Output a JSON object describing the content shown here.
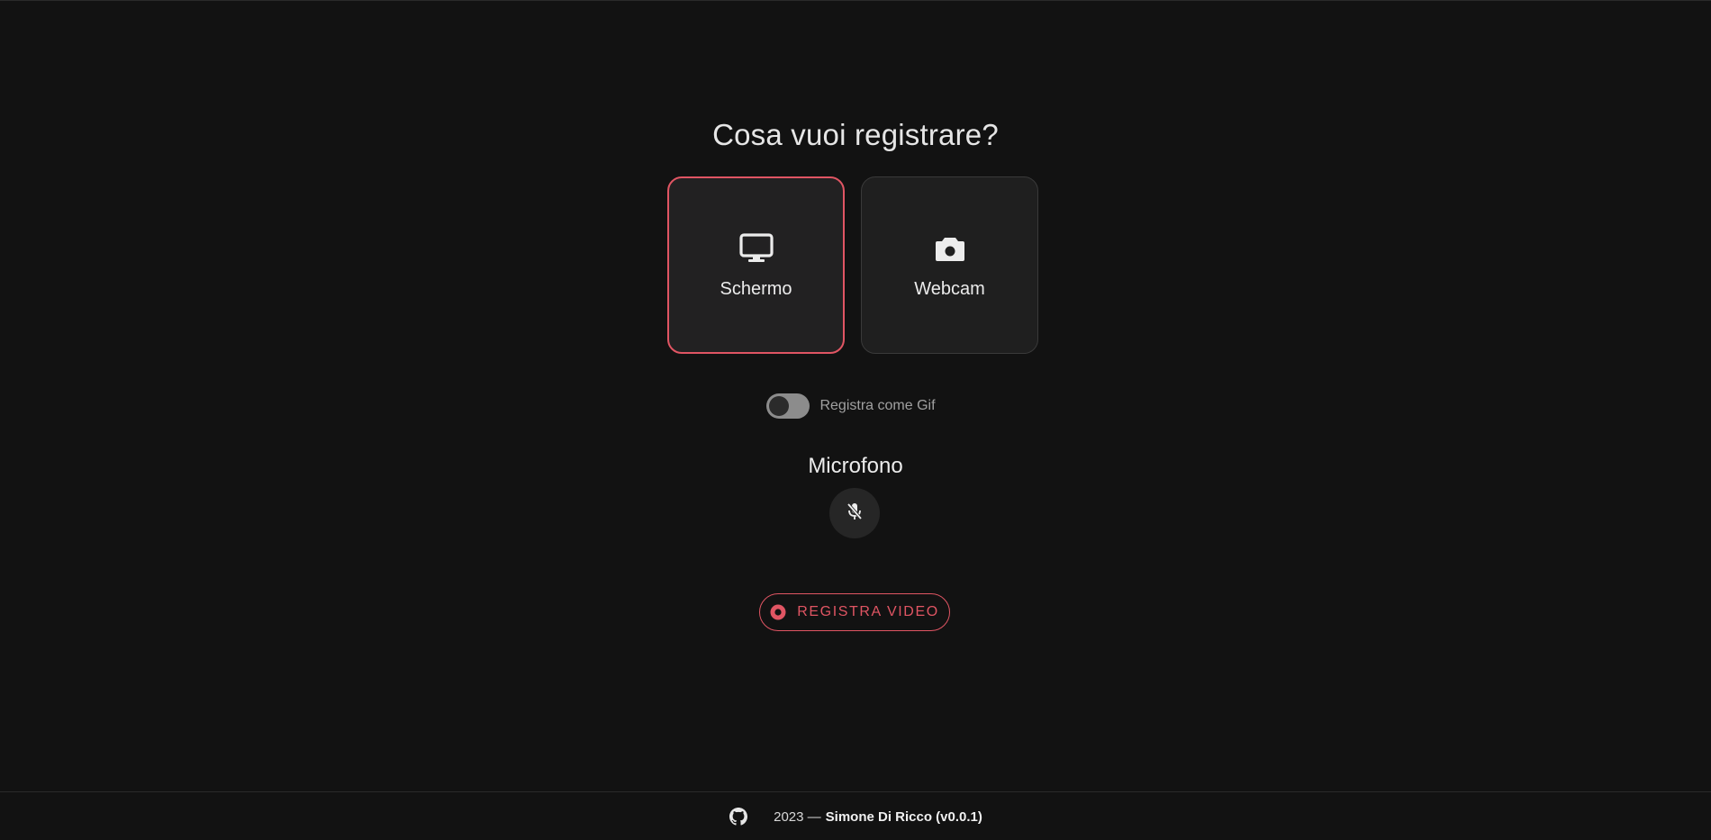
{
  "page": {
    "title": "Cosa vuoi registrare?"
  },
  "choices": [
    {
      "label": "Schermo",
      "icon": "monitor-icon",
      "selected": true
    },
    {
      "label": "Webcam",
      "icon": "camera-icon",
      "selected": false
    }
  ],
  "gif_toggle": {
    "label": "Registra come Gif",
    "checked": false
  },
  "microphone": {
    "title": "Microfono",
    "icon": "mic-off-icon",
    "enabled": false
  },
  "record_button": {
    "label": "REGISTRA VIDEO",
    "icon": "record-icon"
  },
  "footer": {
    "year_text": "2023 —",
    "author": "Simone Di Ricco (v0.0.1)",
    "icon": "github-icon"
  },
  "colors": {
    "background": "#121212",
    "accent": "#e05563",
    "card": "#1f1f1f"
  }
}
